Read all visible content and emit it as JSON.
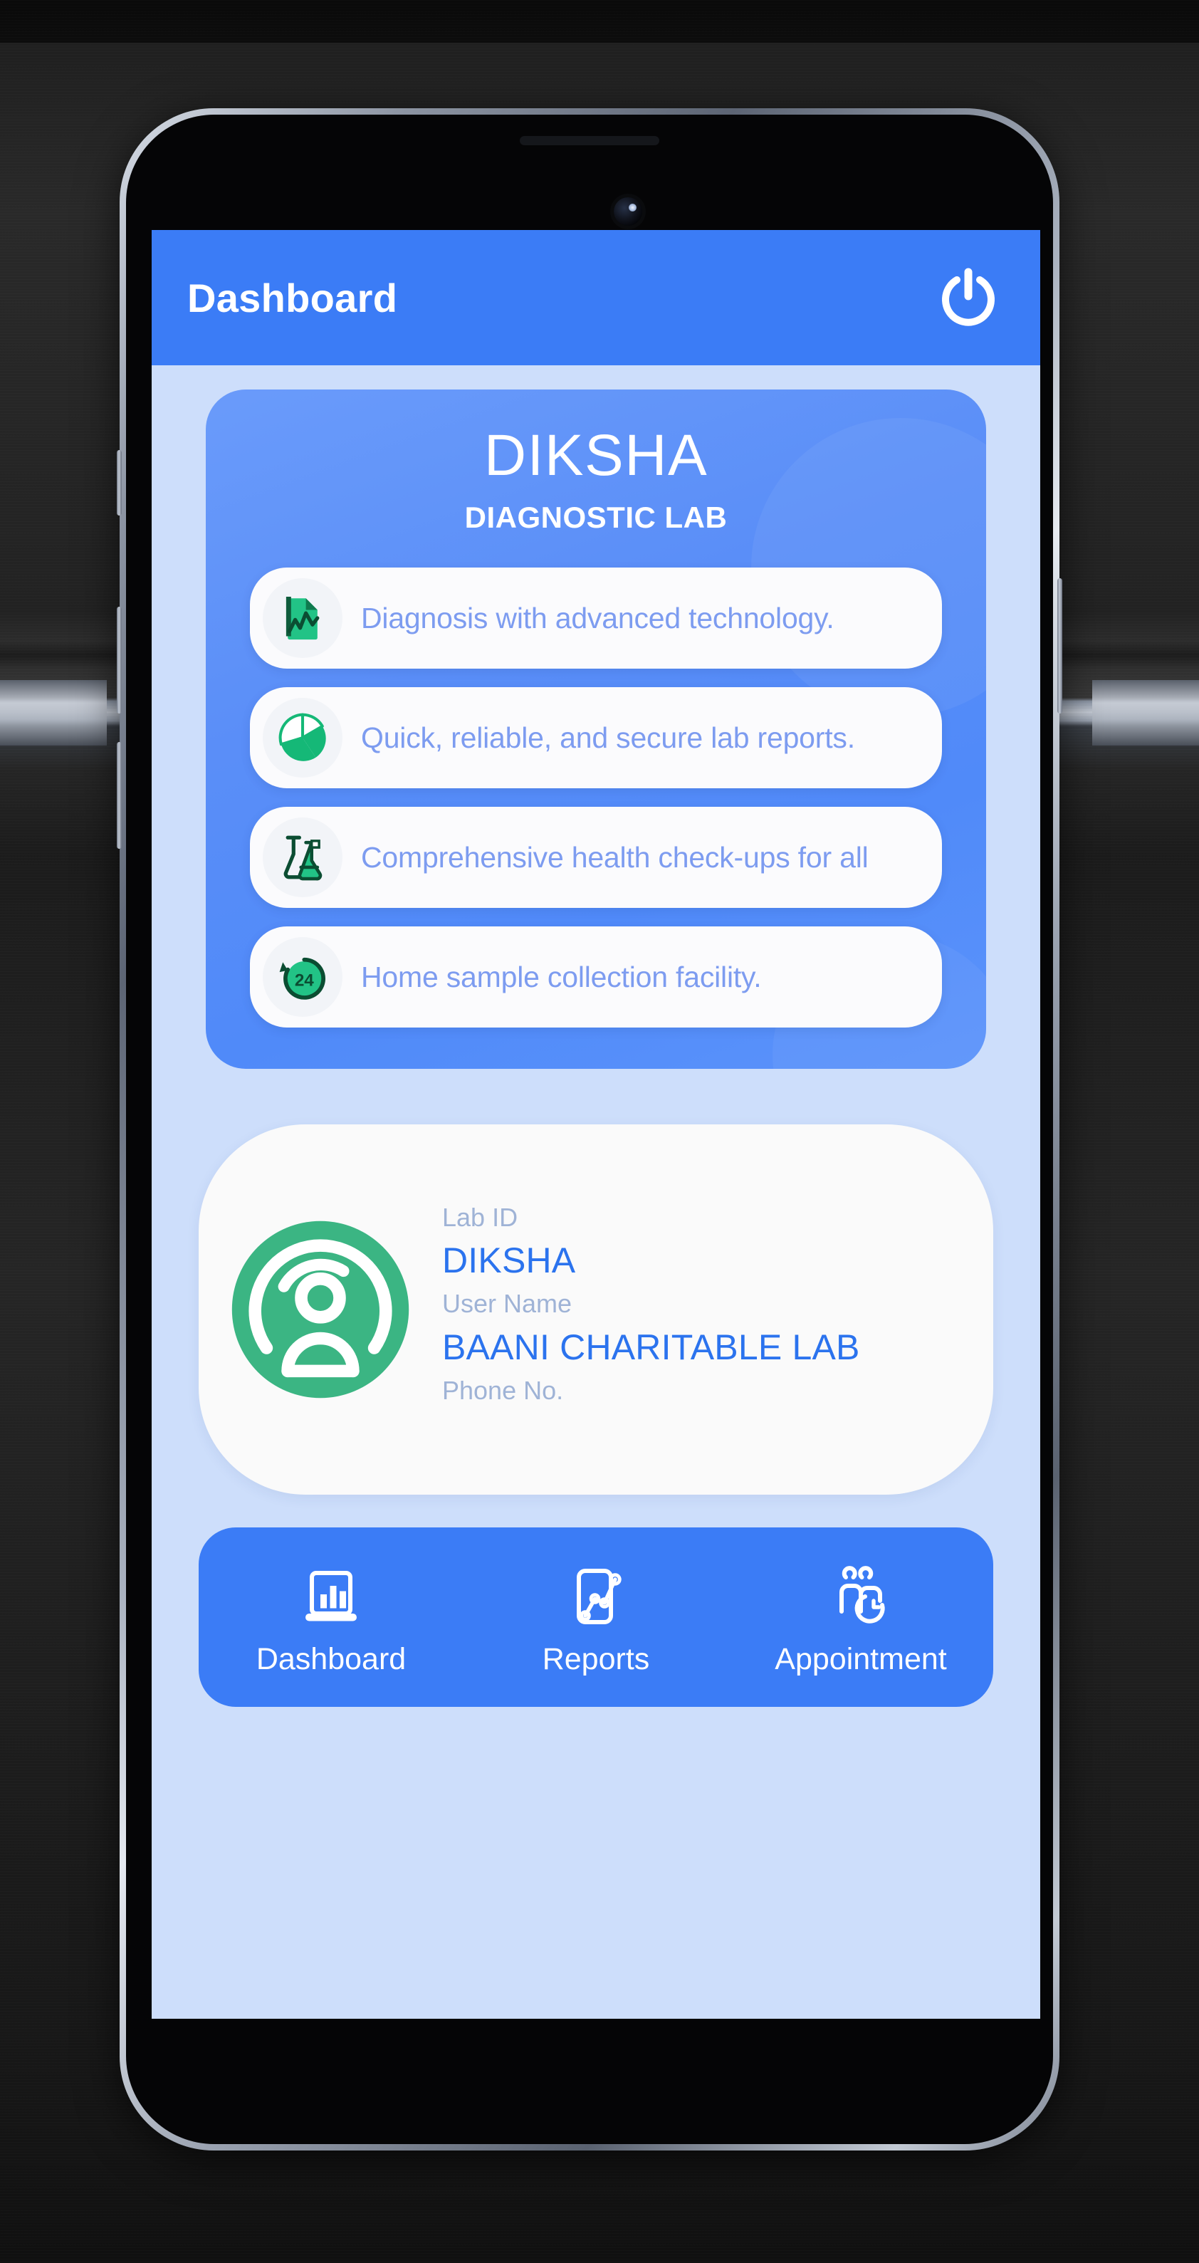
{
  "app": {
    "title": "Dashboard",
    "power_icon": "power-icon"
  },
  "colors": {
    "primary_blue": "#3b7cf6",
    "screen_background": "#cddefb",
    "hero_blue": "#5a8ef8",
    "feature_text_blue": "#7d9cf0",
    "value_blue": "#2b73ee",
    "label_blue": "#9fb3d6",
    "accent_green": "#2bb673",
    "card_white": "#fbfbfd"
  },
  "hero": {
    "brand_name": "DIKSHA",
    "brand_subtitle": "DIAGNOSTIC LAB",
    "features": [
      {
        "icon": "report-document-icon",
        "text": "Diagnosis with advanced technology."
      },
      {
        "icon": "pie-chart-icon",
        "text": "Quick, reliable, and secure lab reports."
      },
      {
        "icon": "lab-flask-icon",
        "text": "Comprehensive health check-ups for all"
      },
      {
        "icon": "twenty-four-hour-icon",
        "text": "Home sample collection facility."
      }
    ]
  },
  "profile": {
    "avatar_icon": "user-avatar-icon",
    "fields": [
      {
        "label": "Lab ID",
        "value": "DIKSHA"
      },
      {
        "label": "User Name",
        "value": "BAANI CHARITABLE LAB"
      },
      {
        "label": "Phone No.",
        "value": ""
      }
    ]
  },
  "bottom_nav": {
    "items": [
      {
        "icon": "dashboard-chart-icon",
        "label": "Dashboard",
        "active": true
      },
      {
        "icon": "reports-graph-icon",
        "label": "Reports",
        "active": false
      },
      {
        "icon": "appointment-people-icon",
        "label": "Appointment",
        "active": false
      }
    ]
  }
}
